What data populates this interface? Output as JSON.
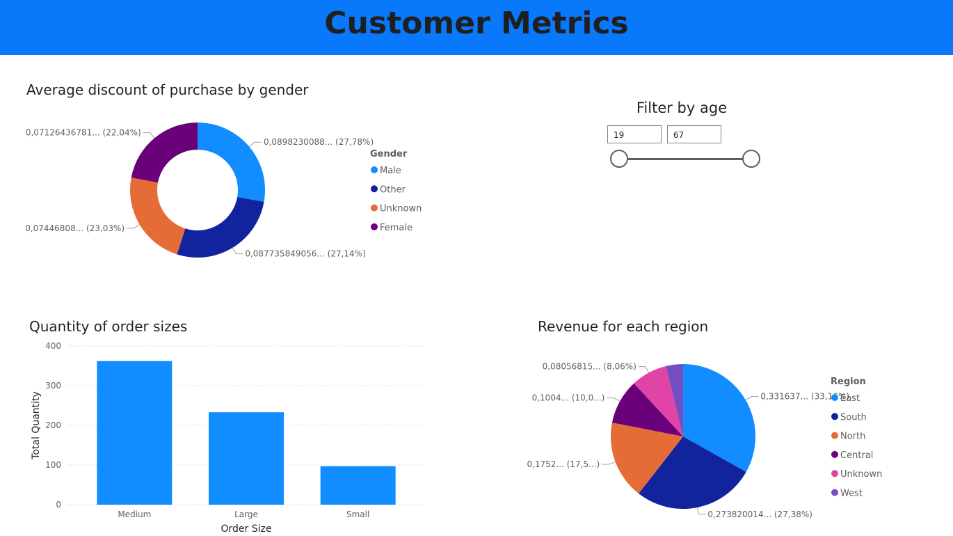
{
  "header": {
    "title": "Customer Metrics"
  },
  "colors": {
    "header_bg": "#0a78fa",
    "blue": "#118dff",
    "dark_blue": "#12239e",
    "orange": "#e66c37",
    "purple": "#6b007b",
    "pink": "#e044a7",
    "violet": "#744ec2"
  },
  "filter": {
    "title": "Filter by age",
    "min_value": "19",
    "max_value": "67"
  },
  "chart_data": [
    {
      "id": "gender_donut",
      "type": "pie",
      "title": "Average discount of purchase by gender",
      "legend_title": "Gender",
      "legend_placement": "right",
      "slices": [
        {
          "name": "Male",
          "value": 0.0898230088,
          "label": "0,0898230088... (27,78%)",
          "color": "#118dff"
        },
        {
          "name": "Other",
          "value": 0.0877358491,
          "label": "0,087735849056... (27,14%)",
          "color": "#12239e"
        },
        {
          "name": "Unknown",
          "value": 0.0744680851,
          "label": "0,07446808... (23,03%)",
          "color": "#e66c37"
        },
        {
          "name": "Female",
          "value": 0.0712643678,
          "label": "0,07126436781... (22,04%)",
          "color": "#6b007b"
        }
      ]
    },
    {
      "id": "order_sizes_bar",
      "type": "bar",
      "title": "Quantity of order sizes",
      "xlabel": "Order Size",
      "ylabel": "Total Quantity",
      "categories": [
        "Medium",
        "Large",
        "Small"
      ],
      "values": [
        362,
        233,
        97
      ],
      "ylim": [
        0,
        400
      ],
      "yticks": [
        "0",
        "100",
        "200",
        "300",
        "400"
      ],
      "grid": true,
      "color": "#118dff"
    },
    {
      "id": "region_pie",
      "type": "pie",
      "title": "Revenue for each region",
      "legend_title": "Region",
      "legend_placement": "right",
      "slices": [
        {
          "name": "East",
          "value": 33.16,
          "label": "0,331637... (33,16%)",
          "color": "#118dff"
        },
        {
          "name": "South",
          "value": 27.38,
          "label": "0,273820014... (27,38%)",
          "color": "#12239e"
        },
        {
          "name": "North",
          "value": 17.52,
          "label": "0,1752... (17,5...)",
          "color": "#e66c37"
        },
        {
          "name": "Central",
          "value": 10.04,
          "label": "0,1004... (10,0...)",
          "color": "#6b007b"
        },
        {
          "name": "Unknown",
          "value": 8.06,
          "label": "0,08056815... (8,06%)",
          "color": "#e044a7"
        },
        {
          "name": "West",
          "value": 3.84,
          "label": "",
          "color": "#744ec2"
        }
      ]
    }
  ]
}
